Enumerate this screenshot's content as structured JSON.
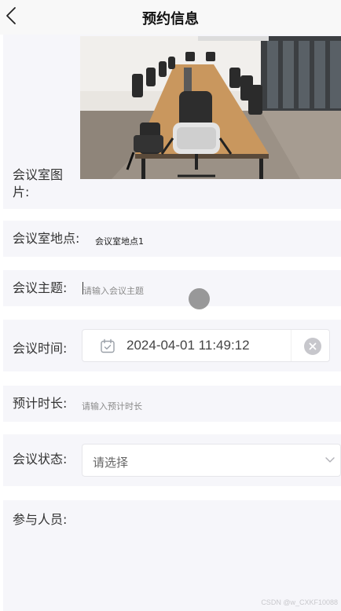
{
  "header": {
    "title": "预约信息",
    "back_icon": "chevron-left-icon"
  },
  "form": {
    "room_image": {
      "label": "会议室图片:"
    },
    "room_location": {
      "label": "会议室地点:",
      "value": "会议室地点1"
    },
    "topic": {
      "label": "会议主题:",
      "placeholder": "请输入会议主题"
    },
    "meeting_time": {
      "label": "会议时间:",
      "value": "2024-04-01 11:49:12",
      "icon": "calendar-icon",
      "clear_icon": "close-circle-icon"
    },
    "duration": {
      "label": "预计时长:",
      "placeholder": "请输入预计时长"
    },
    "status": {
      "label": "会议状态:",
      "placeholder": "请选择",
      "icon": "chevron-down-icon"
    },
    "participants": {
      "label": "参与人员:"
    }
  },
  "watermark": "CSDN @w_CXKF10088"
}
